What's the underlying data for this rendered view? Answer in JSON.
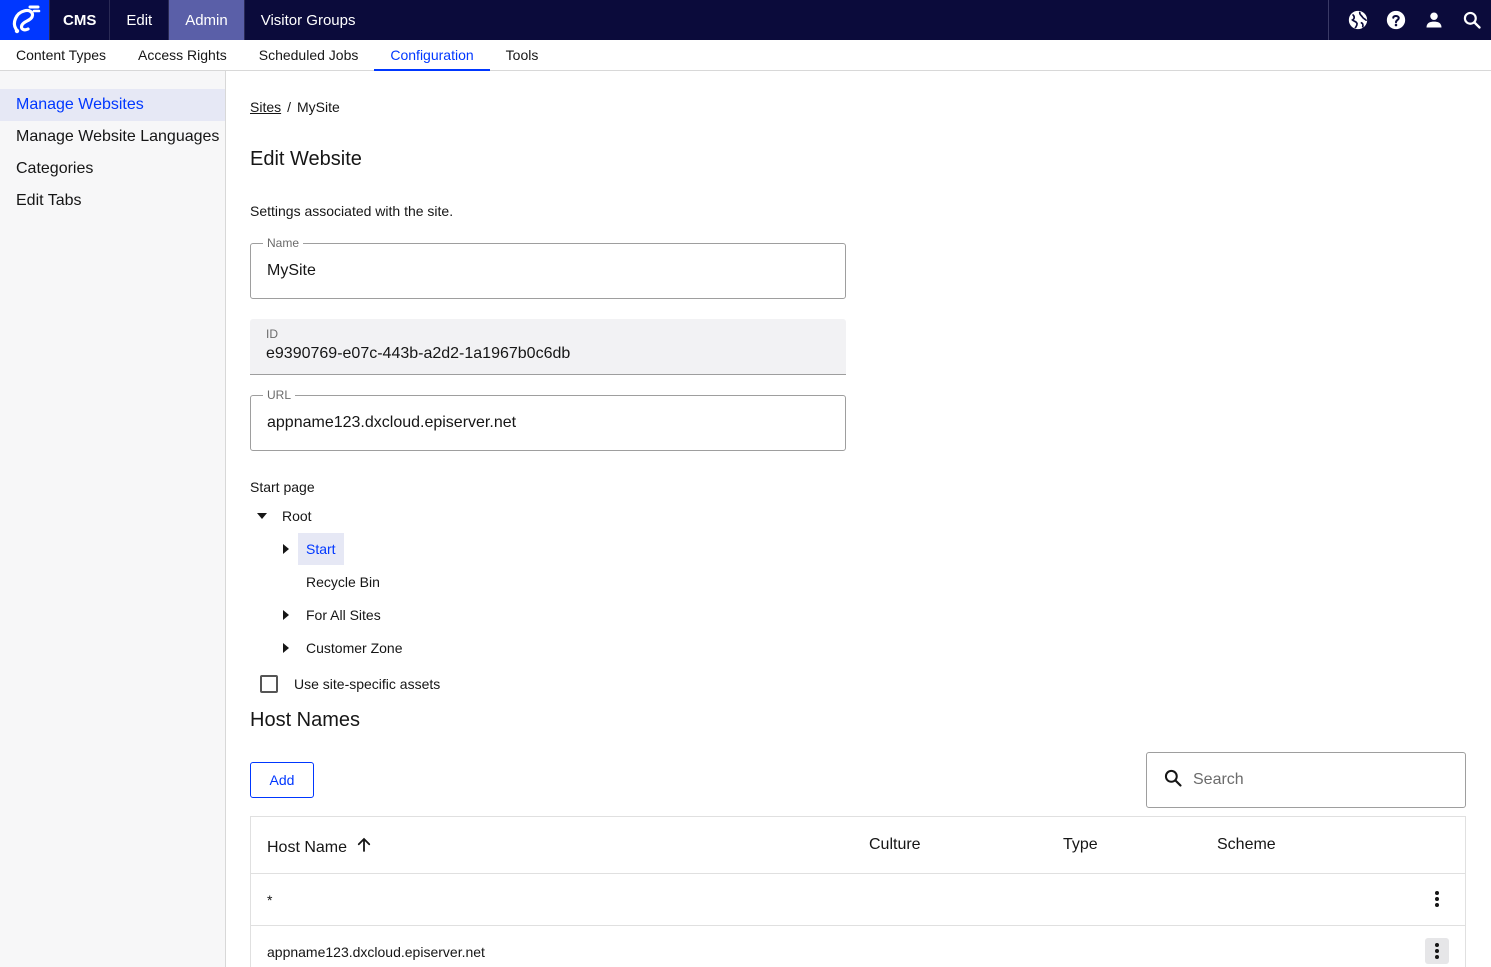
{
  "topbar": {
    "nav": [
      {
        "label": "CMS"
      },
      {
        "label": "Edit"
      },
      {
        "label": "Admin"
      },
      {
        "label": "Visitor Groups"
      }
    ]
  },
  "subnav": {
    "tabs": [
      {
        "label": "Content Types"
      },
      {
        "label": "Access Rights"
      },
      {
        "label": "Scheduled Jobs"
      },
      {
        "label": "Configuration"
      },
      {
        "label": "Tools"
      }
    ]
  },
  "sidebar": {
    "items": [
      {
        "label": "Manage Websites"
      },
      {
        "label": "Manage Website Languages"
      },
      {
        "label": "Categories"
      },
      {
        "label": "Edit Tabs"
      }
    ]
  },
  "breadcrumb": {
    "link": "Sites",
    "separator": "/",
    "current": "MySite"
  },
  "page": {
    "title": "Edit Website",
    "description": "Settings associated with the site."
  },
  "form": {
    "name": {
      "label": "Name",
      "value": "MySite"
    },
    "id": {
      "label": "ID",
      "value": "e9390769-e07c-443b-a2d2-1a1967b0c6db"
    },
    "url": {
      "label": "URL",
      "value": "appname123.dxcloud.episerver.net"
    }
  },
  "start_page": {
    "label": "Start page",
    "root": "Root",
    "children": [
      {
        "label": "Start"
      },
      {
        "label": "Recycle Bin"
      },
      {
        "label": "For All Sites"
      },
      {
        "label": "Customer Zone"
      }
    ]
  },
  "site_assets": {
    "label": "Use site-specific assets"
  },
  "host_names": {
    "title": "Host Names",
    "add_label": "Add",
    "search_placeholder": "Search",
    "columns": [
      "Host Name",
      "Culture",
      "Type",
      "Scheme"
    ],
    "rows": [
      {
        "host": "*"
      },
      {
        "host": "appname123.dxcloud.episerver.net"
      }
    ]
  },
  "colors": {
    "topbar": "#0b0b3b",
    "accent": "#0037ff",
    "active_nav": "#5a5fa8"
  }
}
